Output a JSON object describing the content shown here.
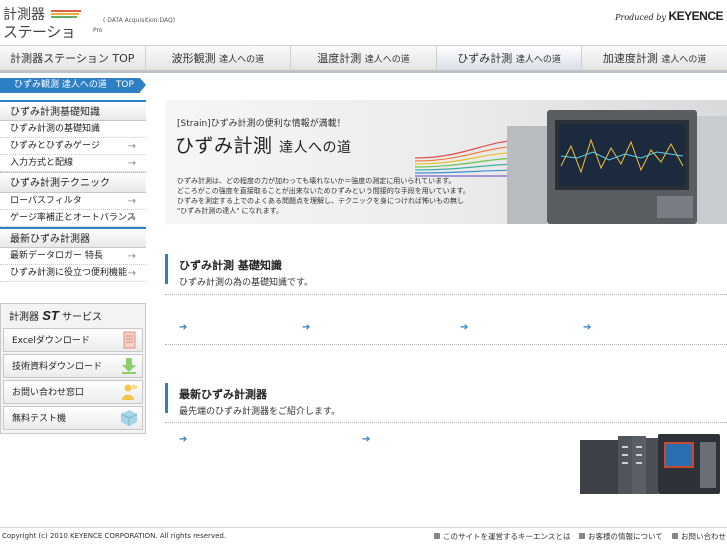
{
  "header": {
    "logo_line1": "計測器",
    "logo_line2": "ステーション",
    "logo_pro": "Pro",
    "logo_sub": "( DATA Acquisition:DAQ)",
    "produced_by": "Produced by ",
    "brand": "KEYENCE"
  },
  "nav": {
    "tabs": [
      {
        "label": "計測器ステーション TOP",
        "suffix": ""
      },
      {
        "label": "波形観測 ",
        "suffix": "達人への道"
      },
      {
        "label": "温度計測 ",
        "suffix": "達人への道"
      },
      {
        "label": "ひずみ計測 ",
        "suffix": "達人への道"
      },
      {
        "label": "加速度計測 ",
        "suffix": "達人への道"
      }
    ]
  },
  "breadcrumb": {
    "label": "ひずみ観測 達人への道　TOP"
  },
  "sidebar": {
    "groups": [
      {
        "title": "ひずみ計測基礎知識",
        "items": [
          "ひずみ計測の基礎知識",
          "ひずみとひずみゲージ",
          "入力方式と配線"
        ]
      },
      {
        "title": "ひずみ計測テクニック",
        "items": [
          "ローパスフィルタ",
          "ゲージ率補正とオートバランス"
        ]
      },
      {
        "title": "最新ひずみ計測器",
        "items": [
          "最新データロガー 特長",
          "ひずみ計測に役立つ便利機能"
        ]
      }
    ],
    "arrow": "→"
  },
  "st_service": {
    "title_pre": "計測器 ",
    "title_st": "ST",
    "title_post": " サービス",
    "buttons": [
      "Excelダウンロード",
      "技術資料ダウンロード",
      "お問い合わせ窓口",
      "無料テスト機"
    ]
  },
  "hero": {
    "tag": "[Strain]ひずみ計測の便利な情報が満載！",
    "title": "ひずみ計測 ",
    "title_sub": "達人への道",
    "text": [
      "ひずみ計測は、どの程度の力が加わっても壊れないか＝強度の測定に用いられています。",
      "どころがこの強度を直接取ることが出来ないためひずみという間接的な手段を用いています。",
      "ひずみを測定する上でのよくある問題点を理解し、テクニックを身につければ怖いもの無し",
      "\"ひずみ計測の達人\" になれます。"
    ]
  },
  "sections": [
    {
      "title": "ひずみ計測 基礎知識",
      "desc": "ひずみ計測の為の基礎知識です。"
    },
    {
      "title": "最新ひずみ計測器",
      "desc": "最先端のひずみ計測器をご紹介します。"
    }
  ],
  "footer": {
    "copyright": "Copyright (c) 2010 KEYENCE CORPORATION. All rights reserved.",
    "links": [
      "このサイトを運営するキーエンスとは",
      "お客様の情報について",
      "お問い合わせ"
    ]
  },
  "colors": {
    "accent": "#2f7fc6",
    "nav_bg": "#e4e4e4"
  }
}
